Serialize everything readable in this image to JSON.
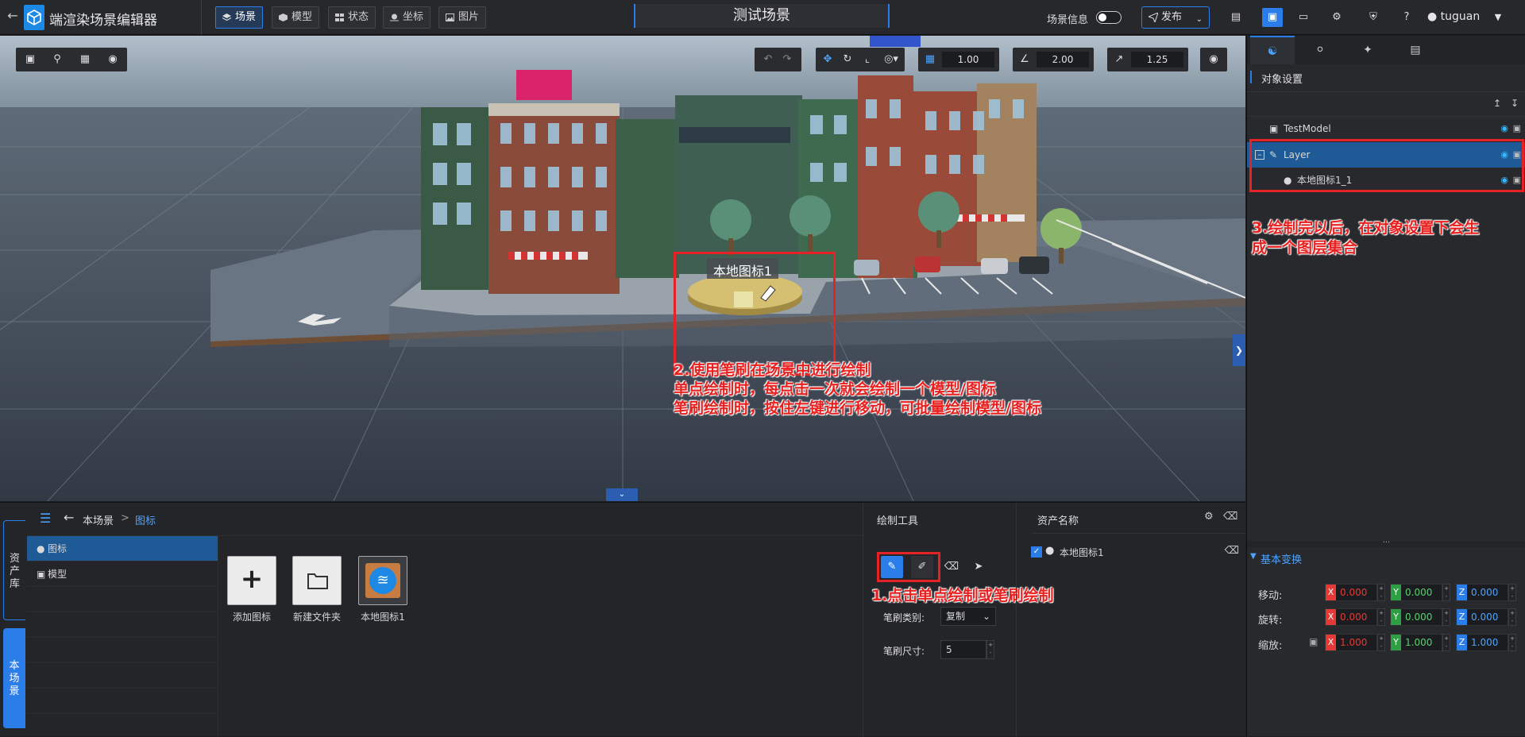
{
  "app": {
    "title": "端渲染场景编辑器",
    "back_icon": "arrow-left-icon",
    "logo_icon": "cube-logo-icon"
  },
  "top_tabs": [
    {
      "label": "场景",
      "icon": "layers-icon",
      "active": true
    },
    {
      "label": "模型",
      "icon": "cube-icon",
      "active": false
    },
    {
      "label": "状态",
      "icon": "grid-icon",
      "active": false
    },
    {
      "label": "坐标",
      "icon": "location-icon",
      "active": false
    },
    {
      "label": "图片",
      "icon": "image-icon",
      "active": false
    }
  ],
  "scene_title": "测试场景",
  "scene_info": {
    "label": "场景信息",
    "enabled": false
  },
  "publish": {
    "label": "发布"
  },
  "user": {
    "name": "tuguan"
  },
  "viewport": {
    "undo_icon": "undo-icon",
    "redo_icon": "redo-icon",
    "grid_value": "1.00",
    "angle_value": "2.00",
    "scale_value": "1.25",
    "label": "本地图标1",
    "collapse_icon": "chevron-down-icon",
    "expand_icon": "chevron-right-icon"
  },
  "annotations": {
    "step2": [
      "2.使用笔刷在场景中进行绘制",
      "单点绘制时，每点击一次就会绘制一个模型/图标",
      "笔刷绘制时，按住左键进行移动，可批量绘制模型/图标"
    ],
    "step3": [
      "3.绘制完以后，在对象设置下会生",
      "成一个图层集合"
    ],
    "step1": "1.点击单点绘制或笔刷绘制"
  },
  "right_panel": {
    "section_title": "对象设置",
    "tree": [
      {
        "label": "TestModel",
        "icon": "cube-icon",
        "indent": 0,
        "selected": false
      },
      {
        "label": "Layer",
        "icon": "layer-brush-icon",
        "indent": 1,
        "selected": true
      },
      {
        "label": "本地图标1_1",
        "icon": "marker-icon",
        "indent": 2,
        "selected": false
      }
    ],
    "transform": {
      "title": "基本变换",
      "rows": [
        {
          "label": "移动:",
          "x": "0.000",
          "y": "0.000",
          "z": "0.000"
        },
        {
          "label": "旋转:",
          "x": "0.000",
          "y": "0.000",
          "z": "0.000"
        },
        {
          "label": "缩放:",
          "x": "1.000",
          "y": "1.000",
          "z": "1.000"
        }
      ],
      "axis_colors": {
        "x": "#e53935",
        "y": "#2e9e44",
        "z": "#2b7de9"
      }
    }
  },
  "bottom": {
    "side_tabs": [
      {
        "label": "资产库",
        "active": false
      },
      {
        "label": "本场景",
        "active": true
      }
    ],
    "breadcrumb": {
      "root": "本场景",
      "current": "图标",
      "separator": ">"
    },
    "tree": [
      {
        "label": "图标",
        "icon": "marker-icon",
        "selected": true
      },
      {
        "label": "模型",
        "icon": "cube-icon",
        "selected": false
      }
    ],
    "assets": [
      {
        "label": "添加图标",
        "icon": "plus-icon"
      },
      {
        "label": "新建文件夹",
        "icon": "folder-icon"
      },
      {
        "label": "本地图标1",
        "icon": "wifi-icon"
      }
    ],
    "draw_tools": {
      "title": "绘制工具",
      "brush_type_label": "笔刷类别:",
      "brush_type_value": "复制",
      "brush_size_label": "笔刷尺寸:",
      "brush_size_value": "5"
    },
    "asset_list": {
      "title": "资产名称",
      "items": [
        {
          "label": "本地图标1",
          "checked": true
        }
      ]
    }
  },
  "colors": {
    "accent": "#2b7de9",
    "annotation_red": "#e52326",
    "selected_row": "#1e5a96"
  }
}
